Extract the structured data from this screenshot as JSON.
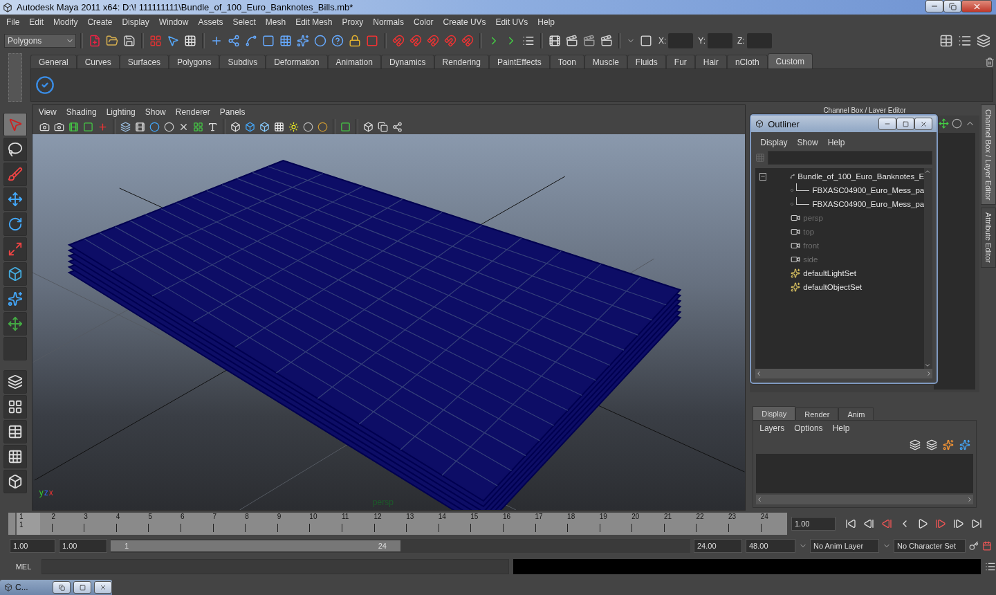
{
  "window": {
    "title": "Autodesk Maya 2011 x64: D:\\! 111111111\\Bundle_of_100_Euro_Banknotes_Bills.mb*"
  },
  "menu_bar": [
    "File",
    "Edit",
    "Modify",
    "Create",
    "Display",
    "Window",
    "Assets",
    "Select",
    "Mesh",
    "Edit Mesh",
    "Proxy",
    "Normals",
    "Color",
    "Create UVs",
    "Edit UVs",
    "Help"
  ],
  "status_line": {
    "mode": "Polygons",
    "coordinate_labels": [
      "X:",
      "Y:",
      "Z:"
    ]
  },
  "shelf": {
    "tabs": [
      {
        "label": "General",
        "selected": false
      },
      {
        "label": "Curves",
        "selected": false
      },
      {
        "label": "Surfaces",
        "selected": false
      },
      {
        "label": "Polygons",
        "selected": false
      },
      {
        "label": "Subdivs",
        "selected": false
      },
      {
        "label": "Deformation",
        "selected": false
      },
      {
        "label": "Animation",
        "selected": false
      },
      {
        "label": "Dynamics",
        "selected": false
      },
      {
        "label": "Rendering",
        "selected": false
      },
      {
        "label": "PaintEffects",
        "selected": false
      },
      {
        "label": "Toon",
        "selected": false
      },
      {
        "label": "Muscle",
        "selected": false
      },
      {
        "label": "Fluids",
        "selected": false
      },
      {
        "label": "Fur",
        "selected": false
      },
      {
        "label": "Hair",
        "selected": false
      },
      {
        "label": "nCloth",
        "selected": false
      },
      {
        "label": "Custom",
        "selected": true
      }
    ]
  },
  "viewport": {
    "menus": [
      "View",
      "Shading",
      "Lighting",
      "Show",
      "Renderer",
      "Panels"
    ],
    "camera_label": "persp",
    "axis_labels": [
      "y",
      "z",
      "x"
    ]
  },
  "channel_box": {
    "title": "Channel Box / Layer Editor"
  },
  "side_tabs": [
    {
      "label": "Channel Box / Layer Editor",
      "selected": true
    },
    {
      "label": "Attribute Editor",
      "selected": false
    }
  ],
  "outliner": {
    "title": "Outliner",
    "menus": [
      "Display",
      "Show",
      "Help"
    ],
    "items": [
      {
        "label": "Bundle_of_100_Euro_Banknotes_E",
        "kind": "transform",
        "dimmed": false,
        "expanded": true,
        "children": [
          {
            "label": "FBXASC04900_Euro_Mess_pa",
            "kind": "mesh",
            "dimmed": false
          },
          {
            "label": "FBXASC04900_Euro_Mess_pa",
            "kind": "mesh",
            "dimmed": false
          }
        ]
      },
      {
        "label": "persp",
        "kind": "camera",
        "dimmed": true
      },
      {
        "label": "top",
        "kind": "camera",
        "dimmed": true
      },
      {
        "label": "front",
        "kind": "camera",
        "dimmed": true
      },
      {
        "label": "side",
        "kind": "camera",
        "dimmed": true
      },
      {
        "label": "defaultLightSet",
        "kind": "set",
        "dimmed": false
      },
      {
        "label": "defaultObjectSet",
        "kind": "set",
        "dimmed": false
      }
    ]
  },
  "layer_editor": {
    "tabs": [
      {
        "label": "Display",
        "selected": true
      },
      {
        "label": "Render",
        "selected": false
      },
      {
        "label": "Anim",
        "selected": false
      }
    ],
    "menus": [
      "Layers",
      "Options",
      "Help"
    ]
  },
  "time_slider": {
    "ticks": [
      {
        "label": "1",
        "selected": true
      },
      {
        "label": "2",
        "selected": false
      },
      {
        "label": "3",
        "selected": false
      },
      {
        "label": "4",
        "selected": false
      },
      {
        "label": "5",
        "selected": false
      },
      {
        "label": "6",
        "selected": false
      },
      {
        "label": "7",
        "selected": false
      },
      {
        "label": "8",
        "selected": false
      },
      {
        "label": "9",
        "selected": false
      },
      {
        "label": "10",
        "selected": false
      },
      {
        "label": "11",
        "selected": false
      },
      {
        "label": "12",
        "selected": false
      },
      {
        "label": "13",
        "selected": false
      },
      {
        "label": "14",
        "selected": false
      },
      {
        "label": "15",
        "selected": false
      },
      {
        "label": "16",
        "selected": false
      },
      {
        "label": "17",
        "selected": false
      },
      {
        "label": "18",
        "selected": false
      },
      {
        "label": "19",
        "selected": false
      },
      {
        "label": "20",
        "selected": false
      },
      {
        "label": "21",
        "selected": false
      },
      {
        "label": "22",
        "selected": false
      },
      {
        "label": "23",
        "selected": false
      },
      {
        "label": "24",
        "selected": false
      }
    ],
    "current_frame": "1",
    "current_time": "1.00"
  },
  "range_slider": {
    "level": 0.5,
    "start_time": "1.00",
    "playback_start": "1.00",
    "range_start": "1",
    "range_end": "24",
    "playback_end": "24.00",
    "end_time": "48.00",
    "anim_layer": "No Anim Layer",
    "character_set": "No Character Set"
  },
  "command_line": {
    "label": "MEL"
  },
  "taskbar": {
    "label": "C..."
  }
}
